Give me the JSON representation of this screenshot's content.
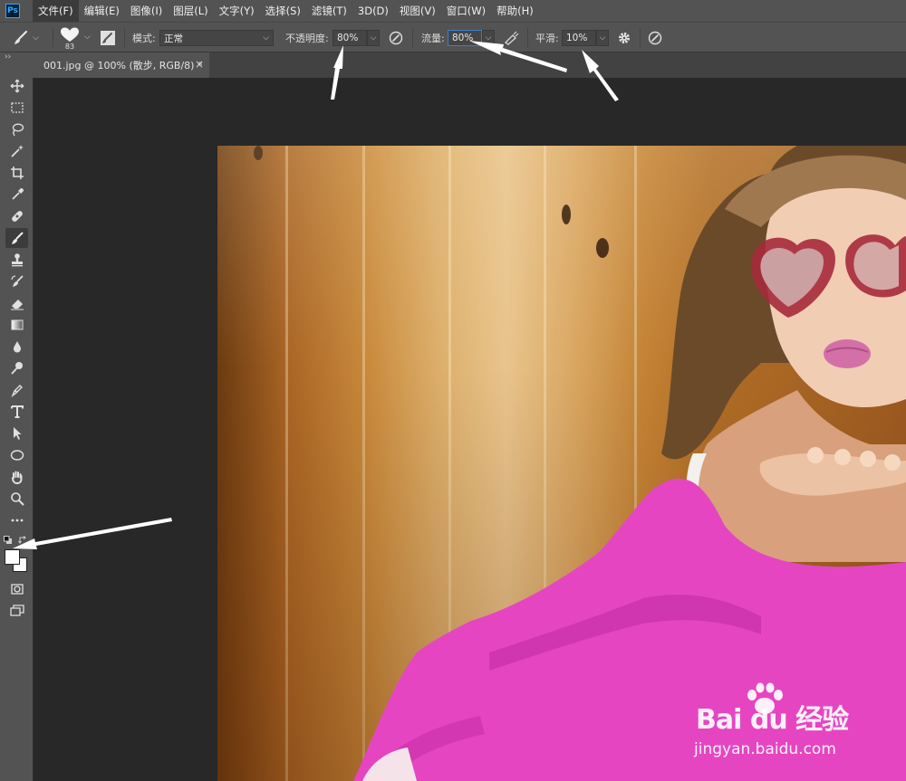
{
  "app": {
    "logo_text": "Ps"
  },
  "menu": {
    "items": [
      "文件(F)",
      "编辑(E)",
      "图像(I)",
      "图层(L)",
      "文字(Y)",
      "选择(S)",
      "滤镜(T)",
      "3D(D)",
      "视图(V)",
      "窗口(W)",
      "帮助(H)"
    ]
  },
  "options": {
    "brush_size": "83",
    "mode_label": "模式:",
    "mode_value": "正常",
    "opacity_label": "不透明度:",
    "opacity_value": "80%",
    "flow_label": "流量:",
    "flow_value": "80%",
    "smoothing_label": "平滑:",
    "smoothing_value": "10%"
  },
  "document": {
    "tab_title": "001.jpg @ 100% (散步, RGB/8) *",
    "close_glyph": "×"
  },
  "toolbox": {
    "collapse_glyph": "››",
    "active_tool": "brush-tool",
    "foreground_color": "#ffffff",
    "background_color": "#ffffff"
  },
  "watermark": {
    "brand": "Bai du 经验",
    "url": "jingyan.baidu.com"
  },
  "colors": {
    "ui_panel": "#535353",
    "workspace": "#282828",
    "focus_border": "#3b7fcf"
  }
}
